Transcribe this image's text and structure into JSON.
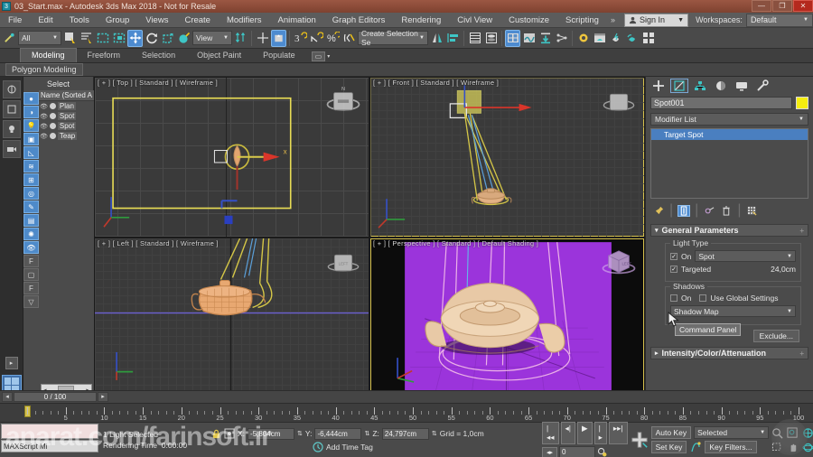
{
  "window": {
    "title": "03_Start.max - Autodesk 3ds Max 2018 - Not for Resale",
    "logo_text": "3",
    "minimize": "—",
    "maximize": "❐",
    "close": "✕"
  },
  "menubar": {
    "items": [
      "File",
      "Edit",
      "Tools",
      "Group",
      "Views",
      "Create",
      "Modifiers",
      "Animation",
      "Graph Editors",
      "Rendering",
      "Civl View",
      "Customize",
      "Scripting"
    ],
    "overflow": "»",
    "signin_label": "Sign In",
    "signin_icon": "user-icon",
    "signin_chevron": "▼",
    "workspaces_label": "Workspaces:",
    "workspace_value": "Default",
    "workspace_chevron": "▼"
  },
  "toolbar": {
    "selection_filter": "All",
    "selection_filter_chevron": "▼",
    "ref_coord_system": "View",
    "ref_coord_chevron": "▼",
    "named_selection_sets": "Create Selection Se",
    "named_selection_chevron": "▼",
    "buttons": [
      {
        "name": "select-link-button",
        "glyph": "⚲"
      },
      {
        "name": "select-object-button",
        "glyph": "◻"
      },
      {
        "name": "select-by-name-button",
        "glyph": "☰"
      },
      {
        "name": "select-region-rect-button",
        "glyph": "▢"
      },
      {
        "name": "select-window-crossing-button",
        "glyph": "▣"
      },
      {
        "name": "select-and-move-button",
        "glyph": "✛"
      },
      {
        "name": "select-and-rotate-button",
        "glyph": "↻"
      },
      {
        "name": "select-and-scale-button",
        "glyph": "⬔"
      },
      {
        "name": "select-and-place-button",
        "glyph": "✍"
      },
      {
        "name": "mirror-button",
        "glyph": "⇅"
      },
      {
        "name": "align-button",
        "glyph": "✛"
      },
      {
        "name": "snaps-toggle-button",
        "glyph": "⬓"
      },
      {
        "name": "angle-snap-button",
        "glyph": "3"
      },
      {
        "name": "percent-snap-button",
        "glyph": "∠"
      },
      {
        "name": "spinner-snap-button",
        "glyph": "%"
      },
      {
        "name": "edit-named-selection-button",
        "glyph": "{ }"
      },
      {
        "name": "mirror-geometry-button",
        "glyph": "◧"
      },
      {
        "name": "align-tools-button",
        "glyph": "⊟"
      },
      {
        "name": "layer-explorer-button",
        "glyph": "▤"
      },
      {
        "name": "curve-editor-button",
        "glyph": "▩"
      },
      {
        "name": "scene-explorer-button",
        "glyph": "▦"
      },
      {
        "name": "schematic-view-button",
        "glyph": "◉"
      },
      {
        "name": "compact-material-editor-button",
        "glyph": "⬇"
      },
      {
        "name": "particle-view-button",
        "glyph": "⚯"
      },
      {
        "name": "render-setup-button",
        "glyph": "☀"
      },
      {
        "name": "rendered-frame-window-button",
        "glyph": "▣"
      },
      {
        "name": "render-production-button",
        "glyph": "⚡"
      },
      {
        "name": "render-iterative-button",
        "glyph": "◐"
      },
      {
        "name": "open-ui-layout-button",
        "glyph": "⌗"
      }
    ]
  },
  "ribbon": {
    "tabs": [
      "Modeling",
      "Freeform",
      "Selection",
      "Object Paint",
      "Populate"
    ],
    "active_tab": "Modeling",
    "overflow_glyph": "▭",
    "overflow_chevron": "▾",
    "subtitle": "Polygon Modeling"
  },
  "scene_explorer": {
    "title": "Select",
    "column_header": "Name (Sorted A",
    "rows": [
      {
        "name": "Plan",
        "type": "object"
      },
      {
        "name": "Spot",
        "type": "light"
      },
      {
        "name": "Spot",
        "type": "light"
      },
      {
        "name": "Teap",
        "type": "object"
      }
    ],
    "scroll_left": "◂",
    "scroll_right": "▸"
  },
  "viewports": [
    {
      "id": "top",
      "label": "[ + ] [ Top ] [ Standard ] [ Wireframe ]",
      "active": false
    },
    {
      "id": "front",
      "label": "[ + ] [ Front ] [ Standard ] [ Wireframe ]",
      "active": true
    },
    {
      "id": "left",
      "label": "[ + ] [ Left ] [ Standard ] [ Wireframe ]",
      "active": false
    },
    {
      "id": "perspective",
      "label": "[ + ] [ Perspective ] [ Standard ] [ Default Shading ]",
      "active": true
    }
  ],
  "command_panel": {
    "tabs": [
      {
        "name": "create-tab",
        "glyph": "✛",
        "active": false
      },
      {
        "name": "modify-tab",
        "glyph": "◺",
        "active": true
      },
      {
        "name": "hierarchy-tab",
        "glyph": "⌸",
        "active": false
      },
      {
        "name": "motion-tab",
        "glyph": "◕",
        "active": false
      },
      {
        "name": "display-tab",
        "glyph": "▭",
        "active": false
      },
      {
        "name": "utilities-tab",
        "glyph": "🔧",
        "active": false
      }
    ],
    "object_name": "Spot001",
    "object_color": "#f5ee10",
    "modifier_list_label": "Modifier List",
    "modifier_list_chevron": "▼",
    "stack_items": [
      "Target Spot"
    ],
    "stack_tools": [
      {
        "name": "pin-stack-button",
        "glyph": "📌",
        "active": false
      },
      {
        "name": "show-end-result-button",
        "glyph": "▯",
        "active": true
      },
      {
        "name": "make-unique-button",
        "glyph": "⚲",
        "active": false
      },
      {
        "name": "remove-modifier-button",
        "glyph": "🗑",
        "active": false
      },
      {
        "name": "configure-modifier-sets-button",
        "glyph": "▥",
        "active": false
      }
    ],
    "rollouts": [
      {
        "title": "General Parameters",
        "expanded": true,
        "expand_glyph": "▾",
        "pin_glyph": "+",
        "light_type": {
          "group_title": "Light Type",
          "on_label": "On",
          "on_checked": true,
          "type_value": "Spot",
          "type_chevron": "▼",
          "targeted_label": "Targeted",
          "targeted_checked": true,
          "target_distance": "24,0cm"
        },
        "shadows": {
          "group_title": "Shadows",
          "on_label": "On",
          "on_checked": false,
          "use_global_label": "Use Global Settings",
          "use_global_checked": false,
          "shadow_type": "Shadow Map",
          "shadow_type_chevron": "▼",
          "exclude_label": "Exclude..."
        }
      },
      {
        "title": "Intensity/Color/Attenuation",
        "expanded": false,
        "expand_glyph": "▸",
        "pin_glyph": "+"
      }
    ],
    "tooltip": "Command Panel"
  },
  "timeline": {
    "current_frame_display": "0 / 100",
    "prev_glyph": "◂",
    "next_glyph": "▸",
    "key_mode_glyph": "∿",
    "start": 0,
    "end": 100,
    "major_labels": [
      5,
      10,
      15,
      20,
      25,
      30,
      35,
      40,
      45,
      50,
      55,
      60,
      65,
      70,
      75,
      80,
      85,
      90,
      95,
      100
    ],
    "playhead_frame": 0
  },
  "status_bar": {
    "maxscript_label": "MAXScript Mi",
    "selection_status": "1 Light Selected",
    "rendering_time_label": "Rendering Time",
    "rendering_time_value": "0:00:00",
    "lock_icon": "lock-icon",
    "transform_icon": "transform-type-in-icon",
    "x_label": "X:",
    "x_value": "-5,804cm",
    "y_label": "Y:",
    "y_value": "-6,444cm",
    "z_label": "Z:",
    "z_value": "24,797cm",
    "grid_label": "Grid = 1,0cm",
    "add_time_tag": "Add Time Tag",
    "auto_key": "Auto Key",
    "set_key": "Set Key",
    "key_filter_mode": "Selected",
    "key_filter_chevron": "▼",
    "key_filters": "Key Filters...",
    "key_spinner_value": "0",
    "playback": [
      {
        "name": "go-to-start-button",
        "glyph": "|◂◂"
      },
      {
        "name": "previous-frame-button",
        "glyph": "◂|"
      },
      {
        "name": "play-animation-button",
        "glyph": "▶"
      },
      {
        "name": "next-frame-button",
        "glyph": "|▸"
      },
      {
        "name": "go-to-end-button",
        "glyph": "▸▸|"
      }
    ],
    "nav_buttons": [
      {
        "name": "zoom-button",
        "glyph": "🔍"
      },
      {
        "name": "zoom-all-button",
        "glyph": "⧉"
      },
      {
        "name": "zoom-extents-button",
        "glyph": "⊕"
      },
      {
        "name": "field-of-view-button",
        "glyph": "◎"
      },
      {
        "name": "zoom-region-button",
        "glyph": "⬚"
      },
      {
        "name": "pan-view-button",
        "glyph": "✋"
      },
      {
        "name": "orbit-button",
        "glyph": "◍"
      },
      {
        "name": "maximize-viewport-toggle-button",
        "glyph": "⬈"
      }
    ]
  },
  "watermark": "anarat.com/farinsoft.ir"
}
